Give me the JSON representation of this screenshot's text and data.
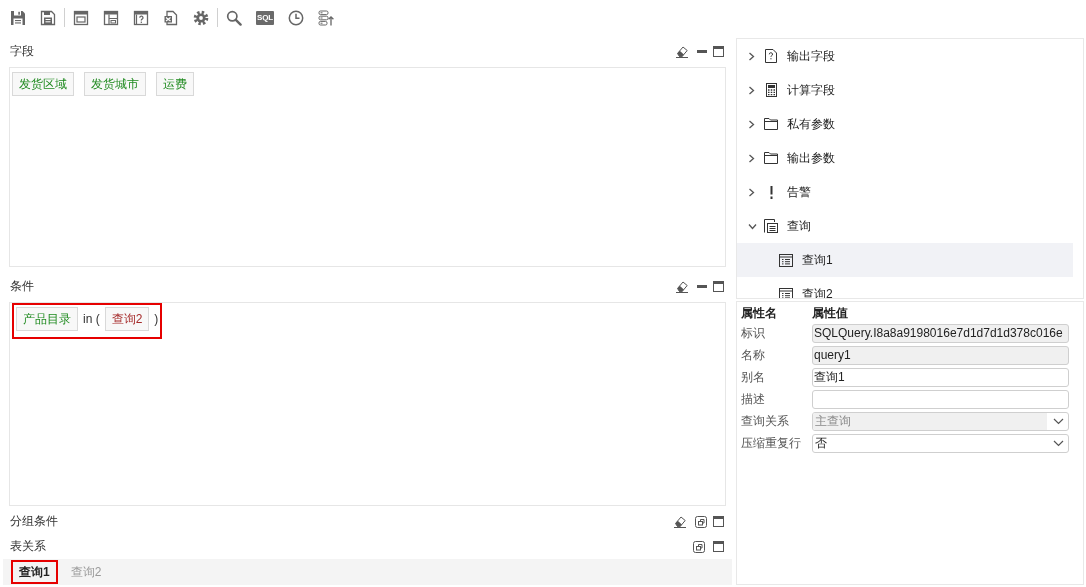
{
  "toolbar": {
    "sql_label": "SQL"
  },
  "sections": [
    {
      "title": "字段",
      "collapsed": false,
      "clearable": true,
      "highlighted": false,
      "tokens": [
        {
          "kind": "field",
          "label": "发货区域"
        },
        {
          "kind": "field",
          "label": "发货城市"
        },
        {
          "kind": "field",
          "label": "运费"
        }
      ]
    },
    {
      "title": "条件",
      "collapsed": false,
      "clearable": true,
      "highlighted": true,
      "tokens": [
        {
          "kind": "field",
          "label": "产品目录"
        },
        {
          "kind": "text",
          "label": "in ("
        },
        {
          "kind": "query",
          "label": "查询2"
        },
        {
          "kind": "text",
          "label": ")"
        }
      ]
    },
    {
      "title": "分组条件",
      "collapsed": true,
      "clearable": true
    },
    {
      "title": "表关系",
      "collapsed": true,
      "clearable": false
    }
  ],
  "query_tabs": [
    {
      "label": "查询1",
      "selected": true,
      "highlighted": true
    },
    {
      "label": "查询2",
      "selected": false,
      "highlighted": false
    }
  ],
  "tree": {
    "items": [
      {
        "label": "输出字段",
        "kind": "output-field",
        "expanded": false,
        "selected": false
      },
      {
        "label": "计算字段",
        "kind": "calculated-field",
        "expanded": false,
        "selected": false
      },
      {
        "label": "私有参数",
        "kind": "folder",
        "expanded": false,
        "selected": false
      },
      {
        "label": "输出参数",
        "kind": "folder",
        "expanded": false,
        "selected": false
      },
      {
        "label": "告警",
        "kind": "alert",
        "expanded": false,
        "selected": false
      },
      {
        "label": "查询",
        "kind": "query",
        "expanded": true,
        "selected": false,
        "children": [
          {
            "label": "查询1",
            "kind": "table",
            "selected": true
          },
          {
            "label": "查询2",
            "kind": "table",
            "selected": false
          }
        ]
      }
    ]
  },
  "properties": {
    "columns": [
      "属性名",
      "属性值"
    ],
    "rows": [
      {
        "label": "标识",
        "kind": "text",
        "value": "SQLQuery.I8a8a9198016e7d1d7d1d378c016e",
        "disabled": true
      },
      {
        "label": "名称",
        "kind": "text",
        "value": "query1",
        "disabled": true
      },
      {
        "label": "别名",
        "kind": "text",
        "value": "查询1",
        "disabled": false
      },
      {
        "label": "描述",
        "kind": "text",
        "disabled": false
      },
      {
        "label": "查询关系",
        "kind": "select",
        "value": "主查询",
        "disabled": true
      },
      {
        "label": "压缩重复行",
        "kind": "select",
        "value": "否",
        "disabled": false
      }
    ]
  }
}
